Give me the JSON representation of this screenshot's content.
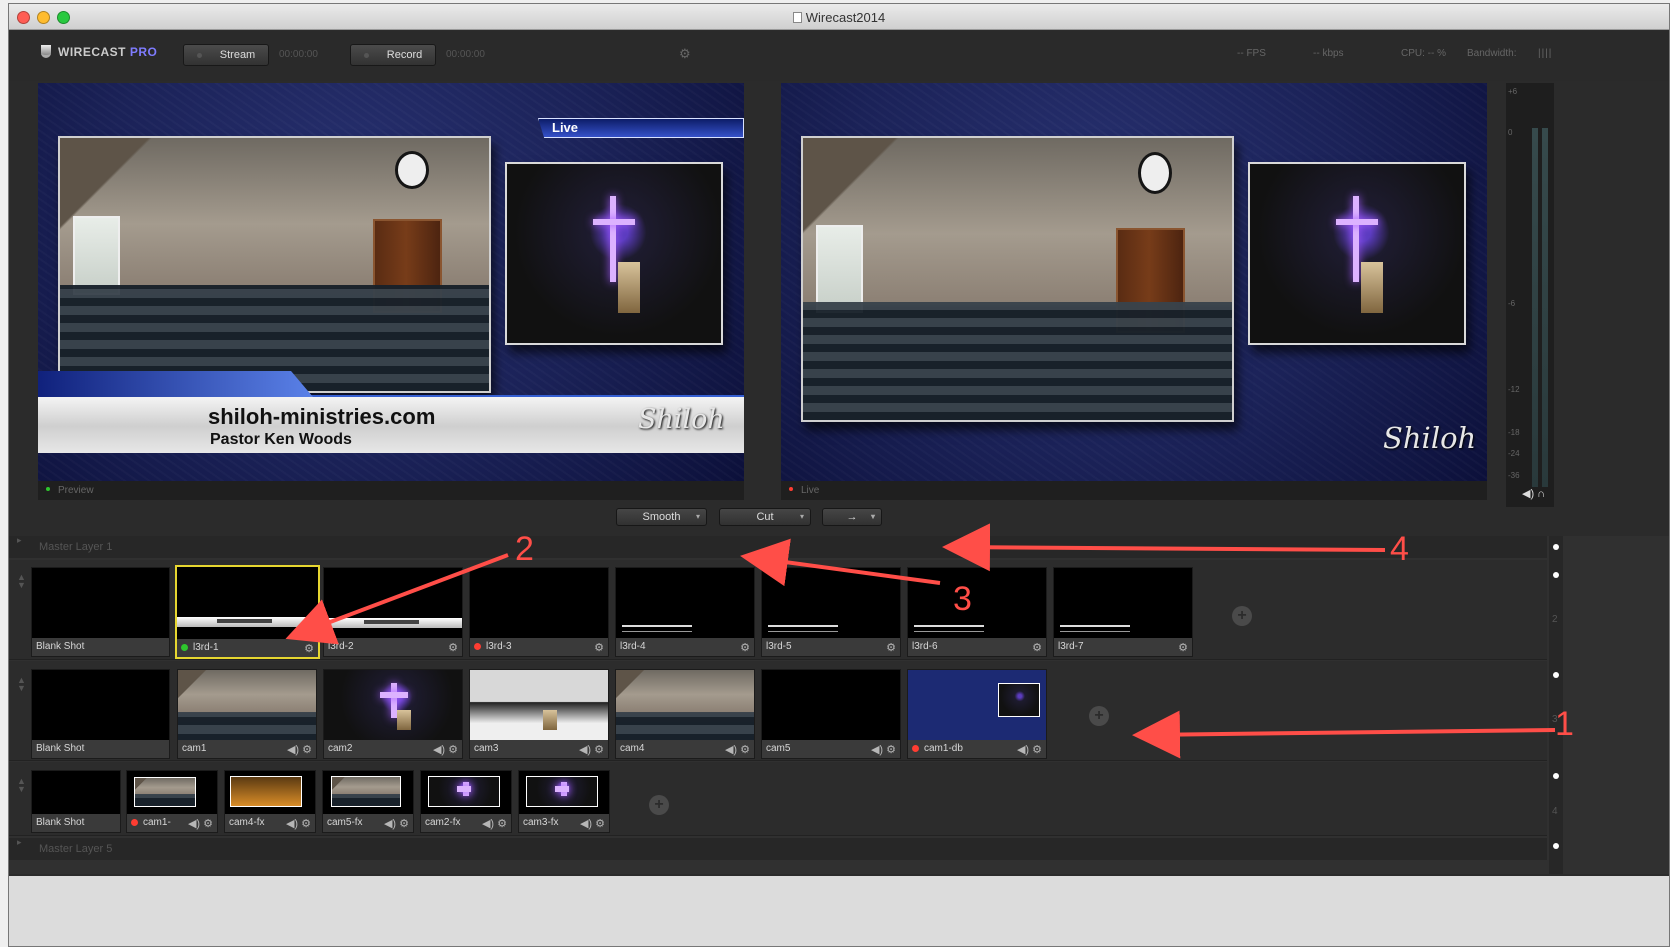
{
  "window": {
    "title": "Wirecast2014"
  },
  "brand": {
    "name": "WIRECAST",
    "suffix": "PRO"
  },
  "toolbar": {
    "stream_label": "Stream",
    "stream_time": "00:00:00",
    "record_label": "Record",
    "record_time": "00:00:00",
    "fps": "-- FPS",
    "kbps": "-- kbps",
    "cpu": "CPU: -- %",
    "bandwidth": "Bandwidth:"
  },
  "preview": {
    "label": "Preview",
    "site": "shiloh-ministries.com",
    "pastor": "Pastor Ken Woods",
    "live_badge": "Live",
    "logo_text": "Shiloh"
  },
  "live": {
    "label": "Live",
    "logo_text": "Shiloh"
  },
  "meter": {
    "ticks": [
      "+6",
      "0",
      "-6",
      "-12",
      "-18",
      "-24",
      "-36"
    ]
  },
  "controls": {
    "transition": "Smooth",
    "cut": "Cut",
    "go": "→"
  },
  "layers": {
    "first": "Master Layer 1",
    "last": "Master Layer 5",
    "row_numbers": [
      "2",
      "3",
      "4"
    ]
  },
  "shots": {
    "row1": [
      "Blank Shot",
      "l3rd-1",
      "l3rd-2",
      "l3rd-3",
      "l3rd-4",
      "l3rd-5",
      "l3rd-6",
      "l3rd-7"
    ],
    "row2": [
      "Blank Shot",
      "cam1",
      "cam2",
      "cam3",
      "cam4",
      "cam5",
      "cam1-db"
    ],
    "row3": [
      "Blank Shot",
      "cam1-",
      "cam4-fx",
      "cam5-fx",
      "cam2-fx",
      "cam3-fx"
    ]
  },
  "annotations": [
    "1",
    "2",
    "3",
    "4"
  ],
  "colors": {
    "accent": "#e6d630",
    "live_dot": "#ff3d32",
    "preview_dot": "#2ec52d",
    "annotation": "#ff4e48"
  }
}
